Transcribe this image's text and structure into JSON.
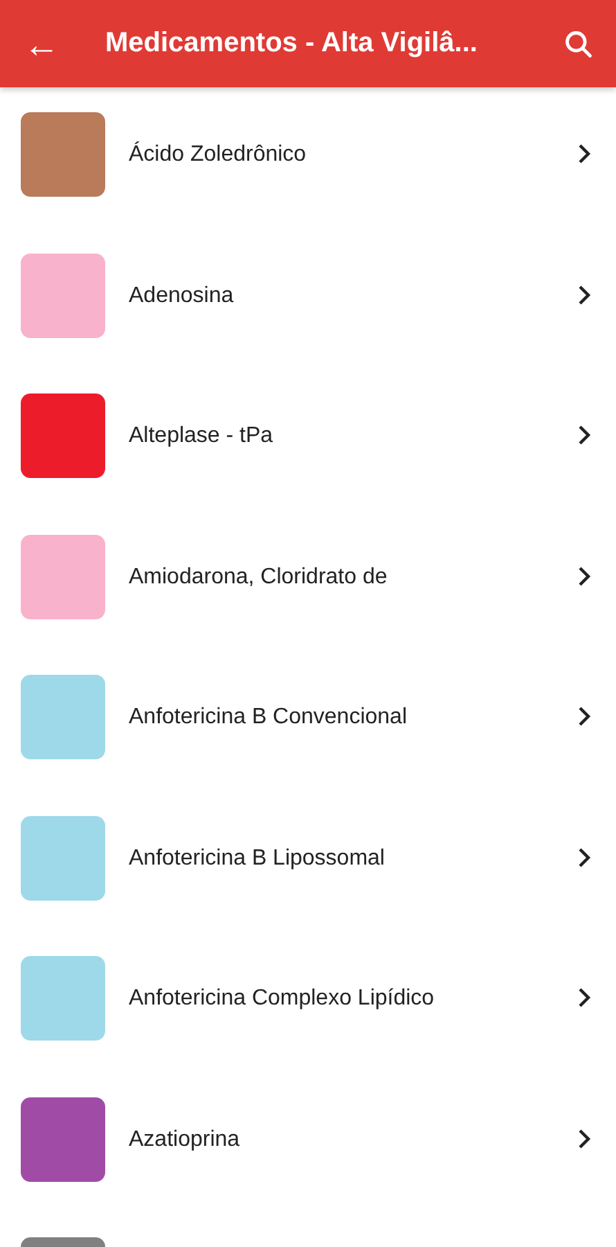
{
  "app_bar": {
    "back_icon": "←",
    "title": "Medicamentos - Alta Vigilâ..."
  },
  "items": [
    {
      "name": "Ácido Zoledrônico",
      "color": "#b97b5a"
    },
    {
      "name": "Adenosina",
      "color": "#f9b2cc"
    },
    {
      "name": "Alteplase - tPa",
      "color": "#ed1c2a"
    },
    {
      "name": "Amiodarona, Cloridrato de",
      "color": "#f9b2cc"
    },
    {
      "name": "Anfotericina B Convencional",
      "color": "#9ed9e9"
    },
    {
      "name": "Anfotericina B Lipossomal",
      "color": "#9ed9e9"
    },
    {
      "name": "Anfotericina Complexo Lipídico",
      "color": "#9ed9e9"
    },
    {
      "name": "Azatioprina",
      "color": "#a04ca6"
    },
    {
      "color": "#808080"
    }
  ]
}
